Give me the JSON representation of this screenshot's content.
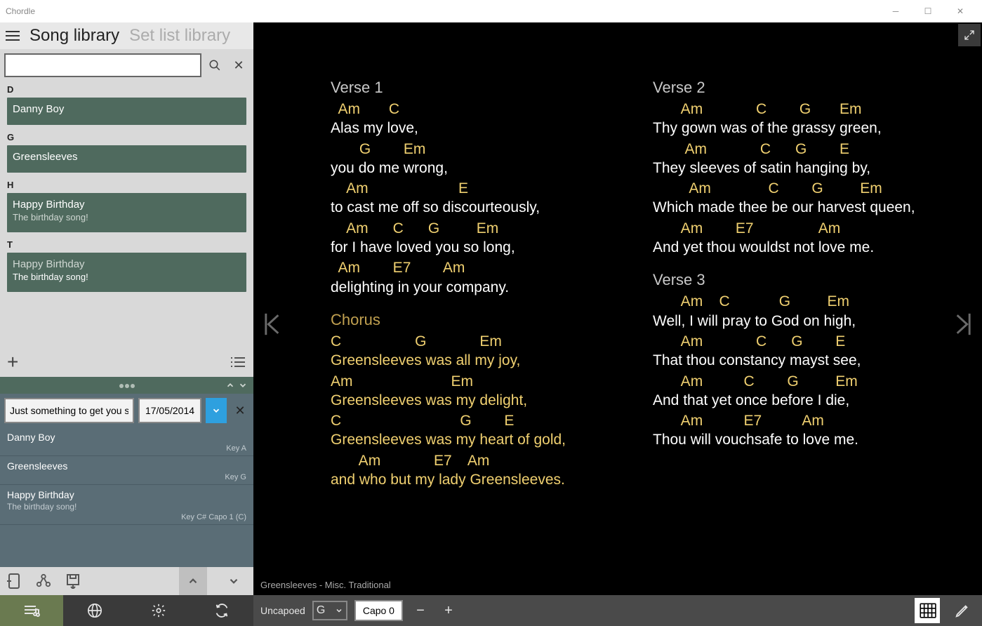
{
  "window": {
    "title": "Chordle"
  },
  "sidebar": {
    "tabs": {
      "songlib": "Song library",
      "setlib": "Set list library"
    },
    "search": {
      "value": ""
    },
    "groups": [
      {
        "letter": "D",
        "songs": [
          {
            "title": "Danny Boy",
            "sub": ""
          }
        ]
      },
      {
        "letter": "G",
        "songs": [
          {
            "title": "Greensleeves",
            "sub": ""
          }
        ]
      },
      {
        "letter": "H",
        "songs": [
          {
            "title": "Happy Birthday",
            "sub": "The birthday song!"
          }
        ]
      },
      {
        "letter": "T",
        "songs": [
          {
            "title": "Happy Birthday",
            "sub": "The birthday song!"
          }
        ]
      }
    ],
    "setlist": {
      "name": "Just something to get you started",
      "date": "17/05/2014",
      "items": [
        {
          "title": "Danny Boy",
          "sub": "",
          "key": "Key A"
        },
        {
          "title": "Greensleeves",
          "sub": "",
          "key": "Key G"
        },
        {
          "title": "Happy Birthday",
          "sub": "The birthday song!",
          "key": "Key C#  Capo 1 (C)"
        }
      ]
    }
  },
  "song": {
    "footer": "Greensleeves -  Misc. Traditional",
    "col1": [
      {
        "name": "Verse 1",
        "class": "",
        "lines": [
          {
            "c": "  Am       C",
            "l": "Alas my love,"
          },
          {
            "c": "       G        Em",
            "l": "you do me wrong,"
          },
          {
            "c": "    Am                      E",
            "l": "to cast me off so discourteously,"
          },
          {
            "c": "    Am      C      G         Em",
            "l": "for I have loved you so long,"
          },
          {
            "c": "  Am        E7        Am",
            "l": "delighting in your company."
          }
        ]
      },
      {
        "name": "Chorus",
        "class": "chorus",
        "lines": [
          {
            "c": "C                  G             Em",
            "l": "Greensleeves was all my joy,"
          },
          {
            "c": "Am                        Em",
            "l": "Greensleeves was my delight,"
          },
          {
            "c": "C                             G        E",
            "l": "Greensleeves was my heart of gold,"
          },
          {
            "c": "       Am             E7    Am",
            "l": "and who but my lady Greensleeves."
          }
        ]
      }
    ],
    "col2": [
      {
        "name": "Verse 2",
        "class": "",
        "lines": [
          {
            "c": "       Am             C        G       Em",
            "l": "Thy gown was of the grassy green,"
          },
          {
            "c": "        Am             C      G        E",
            "l": "They sleeves of satin hanging by,"
          },
          {
            "c": "         Am              C        G         Em",
            "l": "Which made thee be our harvest queen,"
          },
          {
            "c": "       Am        E7                Am",
            "l": "And yet thou wouldst not love me."
          }
        ]
      },
      {
        "name": "Verse 3",
        "class": "",
        "lines": [
          {
            "c": "       Am    C            G         Em",
            "l": "Well, I will pray to God on high,"
          },
          {
            "c": "       Am             C      G        E",
            "l": "That thou constancy mayst see,"
          },
          {
            "c": "       Am          C        G         Em",
            "l": "And that yet once before I die,"
          },
          {
            "c": "       Am          E7          Am",
            "l": "Thou will vouchsafe to love me."
          }
        ]
      }
    ]
  },
  "bottom": {
    "uncapoed": "Uncapoed",
    "key": "G",
    "capo": "Capo 0"
  }
}
